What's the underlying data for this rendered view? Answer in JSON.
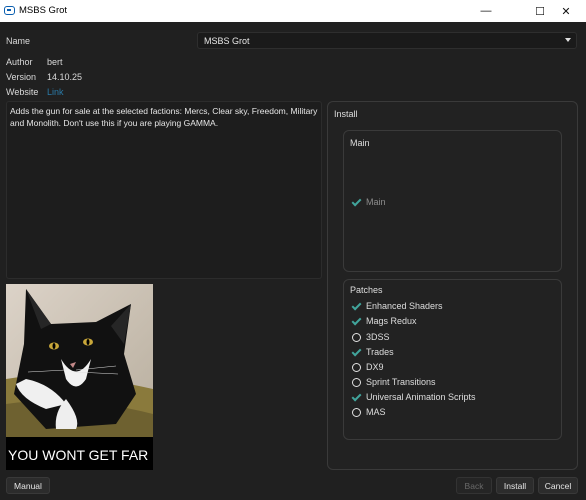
{
  "window": {
    "title": "MSBS Grot",
    "minimize": "—",
    "maximize": "☐",
    "close": "✕"
  },
  "fields": {
    "name_label": "Name",
    "name_value": "MSBS Grot",
    "author_label": "Author",
    "author_value": "bert",
    "version_label": "Version",
    "version_value": "14.10.25",
    "website_label": "Website",
    "website_value": "Link"
  },
  "description": "Adds the gun for sale at the selected factions: Mercs, Clear sky, Freedom, Military and Monolith. Don't use this if you are playing GAMMA.",
  "image": {
    "caption": "YOU WONT GET FAR"
  },
  "install": {
    "title": "Install",
    "main": {
      "title": "Main",
      "options": [
        {
          "label": "Main",
          "checked": true,
          "disabled": true
        }
      ]
    },
    "patches": {
      "title": "Patches",
      "options": [
        {
          "label": "Enhanced Shaders",
          "checked": true
        },
        {
          "label": "Mags Redux",
          "checked": true
        },
        {
          "label": "3DSS",
          "checked": false
        },
        {
          "label": "Trades",
          "checked": true
        },
        {
          "label": "DX9",
          "checked": false
        },
        {
          "label": "Sprint Transitions",
          "checked": false
        },
        {
          "label": "Universal Animation Scripts",
          "checked": true
        },
        {
          "label": "MAS",
          "checked": false
        }
      ]
    }
  },
  "buttons": {
    "manual": "Manual",
    "back": "Back",
    "install": "Install",
    "cancel": "Cancel"
  },
  "colors": {
    "accent_check": "#41a59c",
    "link": "#2a7aa8",
    "background": "#202020"
  }
}
